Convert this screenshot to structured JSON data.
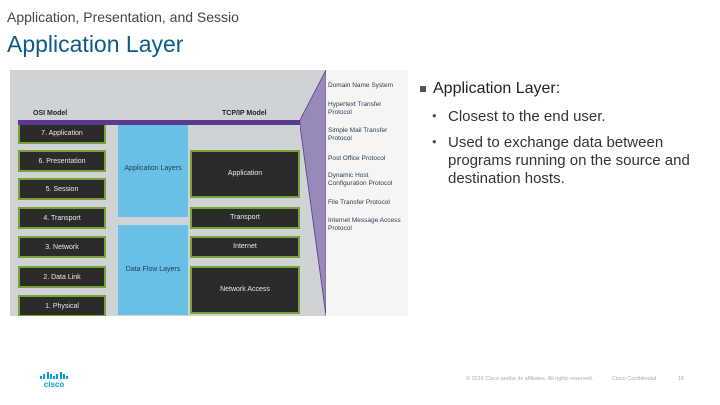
{
  "header": {
    "subtitle": "Application, Presentation, and Sessio",
    "title": "Application Layer"
  },
  "diagram": {
    "osi_heading": "OSI Model",
    "tcp_heading": "TCP/IP Model",
    "osi_layers": [
      "7. Application",
      "6. Presentation",
      "5. Session",
      "4. Transport",
      "3. Network",
      "2. Data Link",
      "1. Physical"
    ],
    "groups": [
      "Application Layers",
      "Data Flow Layers"
    ],
    "tcp_layers": [
      "Application",
      "Transport",
      "Internet",
      "Network Access"
    ],
    "protocols": [
      "Domain Name System",
      "Hypertext Transfer Protocol",
      "Simple Mail Transfer Protocol",
      "Post Office Protocol",
      "Dynamic Host Configuration Protocol",
      "File Transfer Protocol",
      "Internet Message Access Protocol"
    ]
  },
  "content": {
    "heading": "Application Layer:",
    "points": [
      "Closest to the end user.",
      "Used to exchange data between programs running on the source and destination hosts."
    ]
  },
  "footer": {
    "logo": "cisco",
    "copyright": "© 2016 Cisco and/or its affiliates. All rights reserved.",
    "confidential": "Cisco Confidential",
    "page": "16"
  },
  "colors": {
    "title": "#0b5c8a",
    "osi_border": "#7aa23a",
    "group_fill": "#69c0e6",
    "band": "#5b3a8e",
    "logo": "#049fd9"
  }
}
